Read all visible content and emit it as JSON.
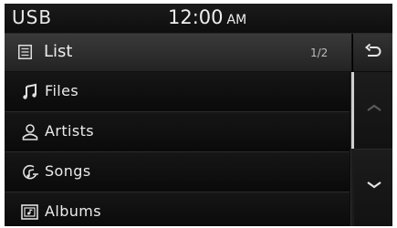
{
  "status": {
    "source": "USB",
    "time": "12:00",
    "ampm": "AM"
  },
  "header": {
    "title": "List",
    "page": "1/2"
  },
  "menu": {
    "items": [
      {
        "label": "Files",
        "icon": "music-note-icon"
      },
      {
        "label": "Artists",
        "icon": "artist-icon"
      },
      {
        "label": "Songs",
        "icon": "songs-icon"
      },
      {
        "label": "Albums",
        "icon": "album-icon"
      }
    ]
  },
  "icons": {
    "back": "back-arrow-icon",
    "list": "list-icon",
    "scroll_up": "chevron-up-icon",
    "scroll_down": "chevron-down-icon"
  },
  "colors": {
    "background": "#0c0c0c",
    "text": "#eaeaea",
    "scroll_thumb": "#cfcfcf"
  }
}
